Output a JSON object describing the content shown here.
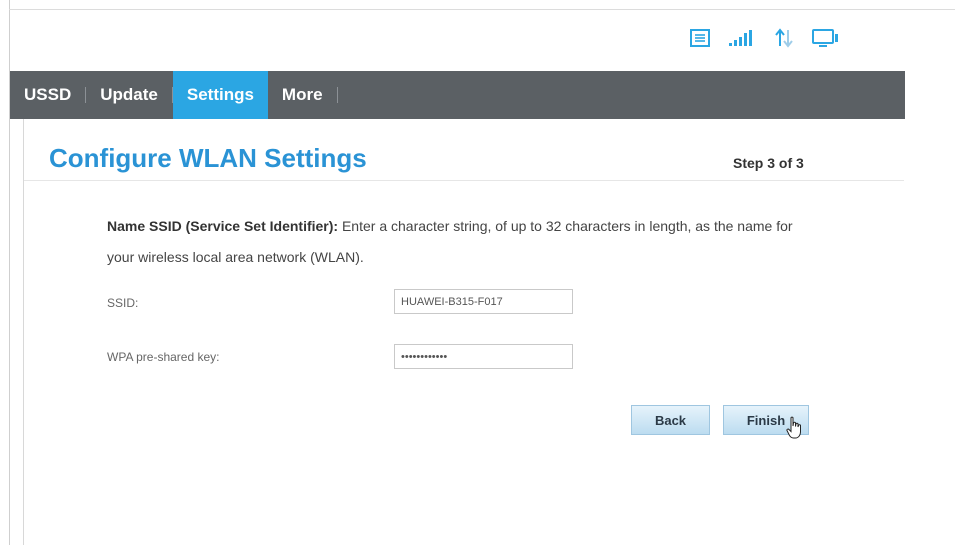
{
  "status_icons": [
    "sms-icon",
    "signal-icon",
    "data-transfer-icon",
    "wifi-clients-icon"
  ],
  "nav": {
    "tabs": [
      {
        "label": "USSD",
        "active": false
      },
      {
        "label": "Update",
        "active": false
      },
      {
        "label": "Settings",
        "active": true
      },
      {
        "label": "More",
        "active": false
      }
    ]
  },
  "page": {
    "title": "Configure WLAN Settings",
    "step": "Step 3 of 3"
  },
  "description": {
    "bold": "Name SSID (Service Set Identifier):",
    "text": " Enter a character string, of up to 32 characters in length, as the name for your wireless local area network (WLAN)."
  },
  "form": {
    "ssid_label": "SSID:",
    "ssid_value": "HUAWEI-B315-F017",
    "wpa_label": "WPA pre-shared key:",
    "wpa_value": "••••••••••••"
  },
  "buttons": {
    "back": "Back",
    "finish": "Finish"
  },
  "colors": {
    "accent": "#2ba6e3",
    "title": "#2a93d5",
    "navbar": "#5b6064"
  }
}
